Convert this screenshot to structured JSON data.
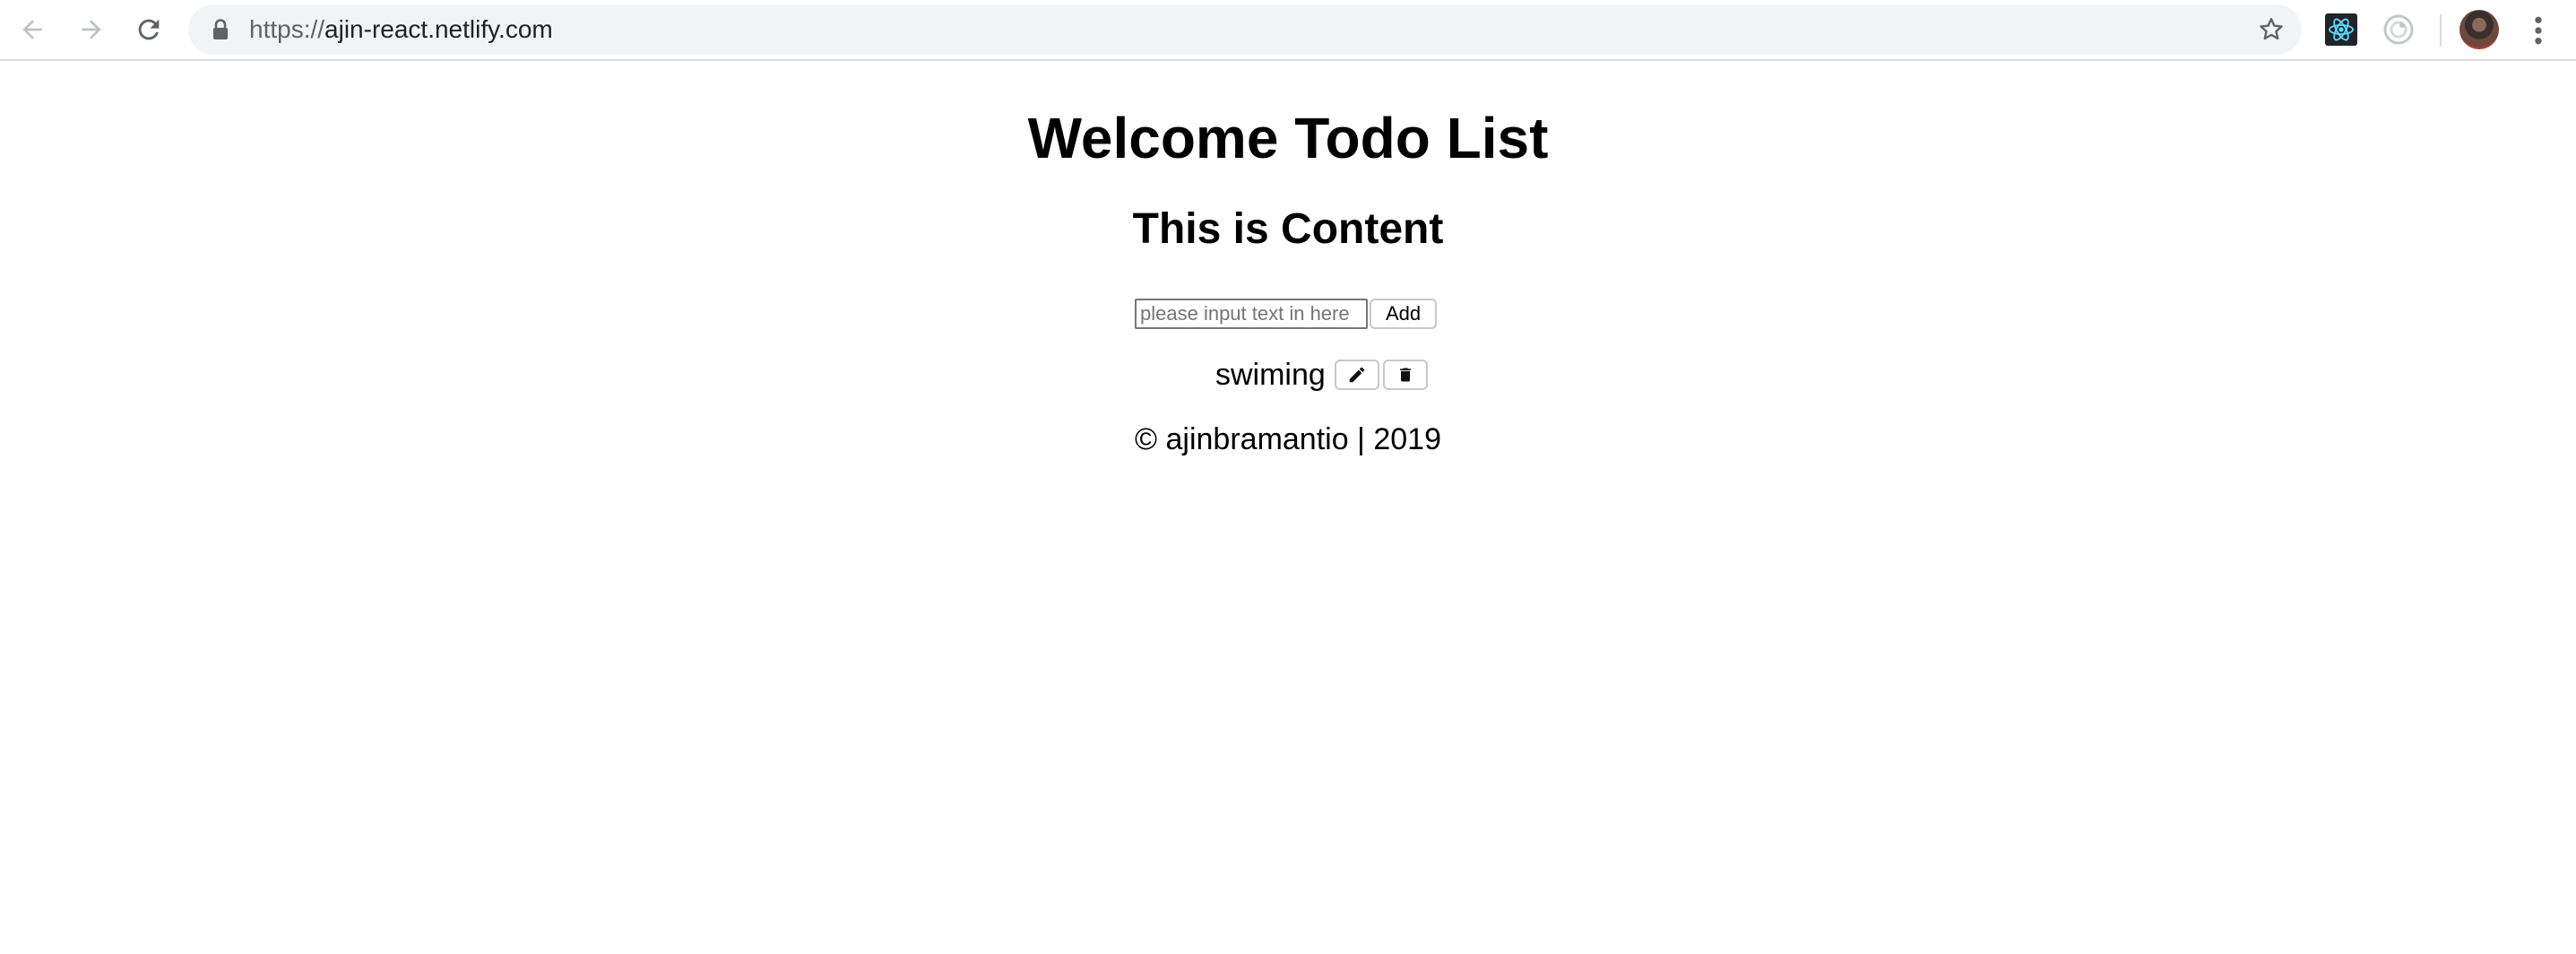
{
  "browser": {
    "url_scheme": "https://",
    "url_host": "ajin-react.netlify.com",
    "icons": {
      "back": "arrow-left-icon",
      "forward": "arrow-right-icon",
      "reload": "reload-icon",
      "lock": "lock-icon",
      "bookmark": "star-icon",
      "extension_react": "react-devtools-icon",
      "extension_other": "extension-icon",
      "profile": "avatar",
      "menu": "kebab-menu-icon"
    }
  },
  "page": {
    "title": "Welcome Todo List",
    "subtitle": "This is Content",
    "input": {
      "placeholder": "please input text in here",
      "value": ""
    },
    "add_label": "Add",
    "todos": [
      {
        "text": "swiming",
        "edit_icon": "pencil-icon",
        "delete_icon": "trash-icon"
      }
    ],
    "footer": "© ajinbramantio | 2019"
  }
}
